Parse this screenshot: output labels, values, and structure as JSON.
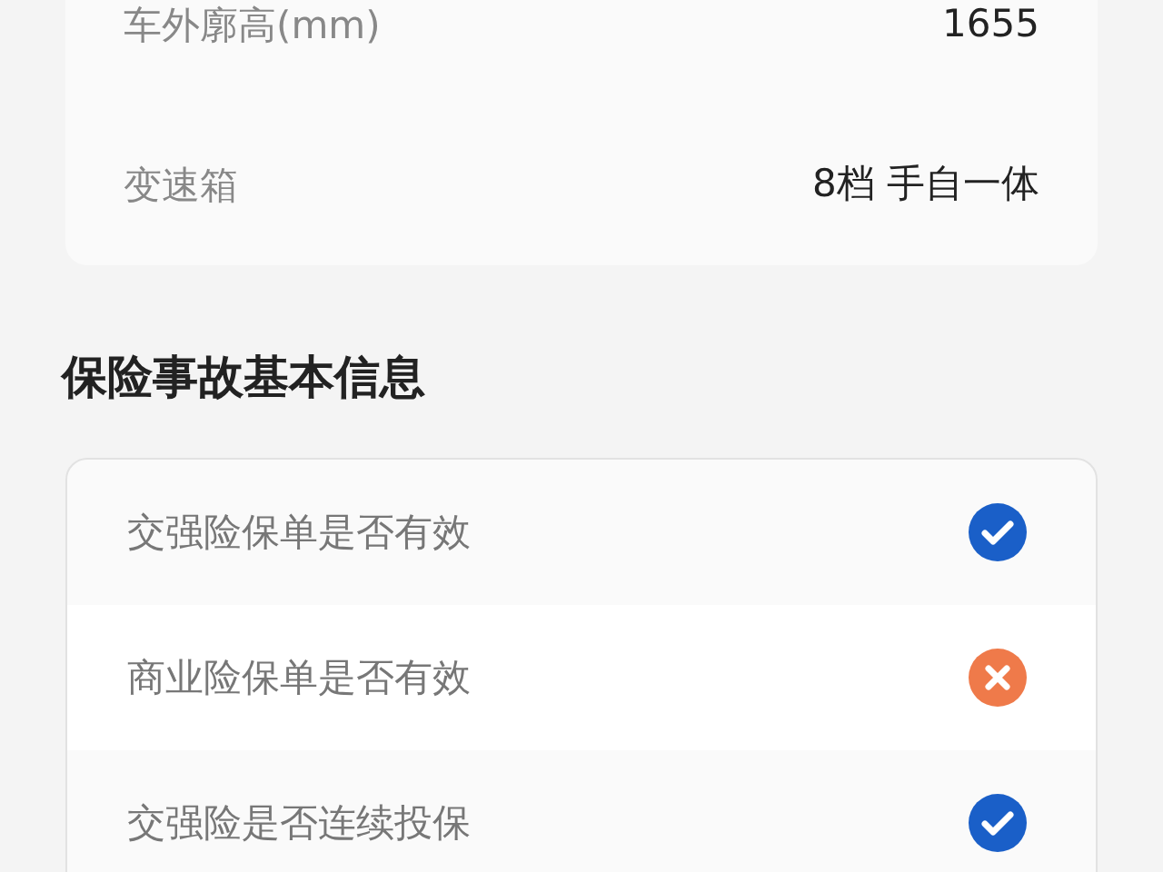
{
  "vehicle_info": [
    {
      "label": "车外廓高(mm)",
      "value": "1655"
    },
    {
      "label": "变速箱",
      "value": "8档 手自一体"
    }
  ],
  "insurance_section": {
    "title": "保险事故基本信息",
    "items": [
      {
        "label": "交强险保单是否有效",
        "valid": true
      },
      {
        "label": "商业险保单是否有效",
        "valid": false
      },
      {
        "label": "交强险是否连续投保",
        "valid": true
      }
    ]
  }
}
